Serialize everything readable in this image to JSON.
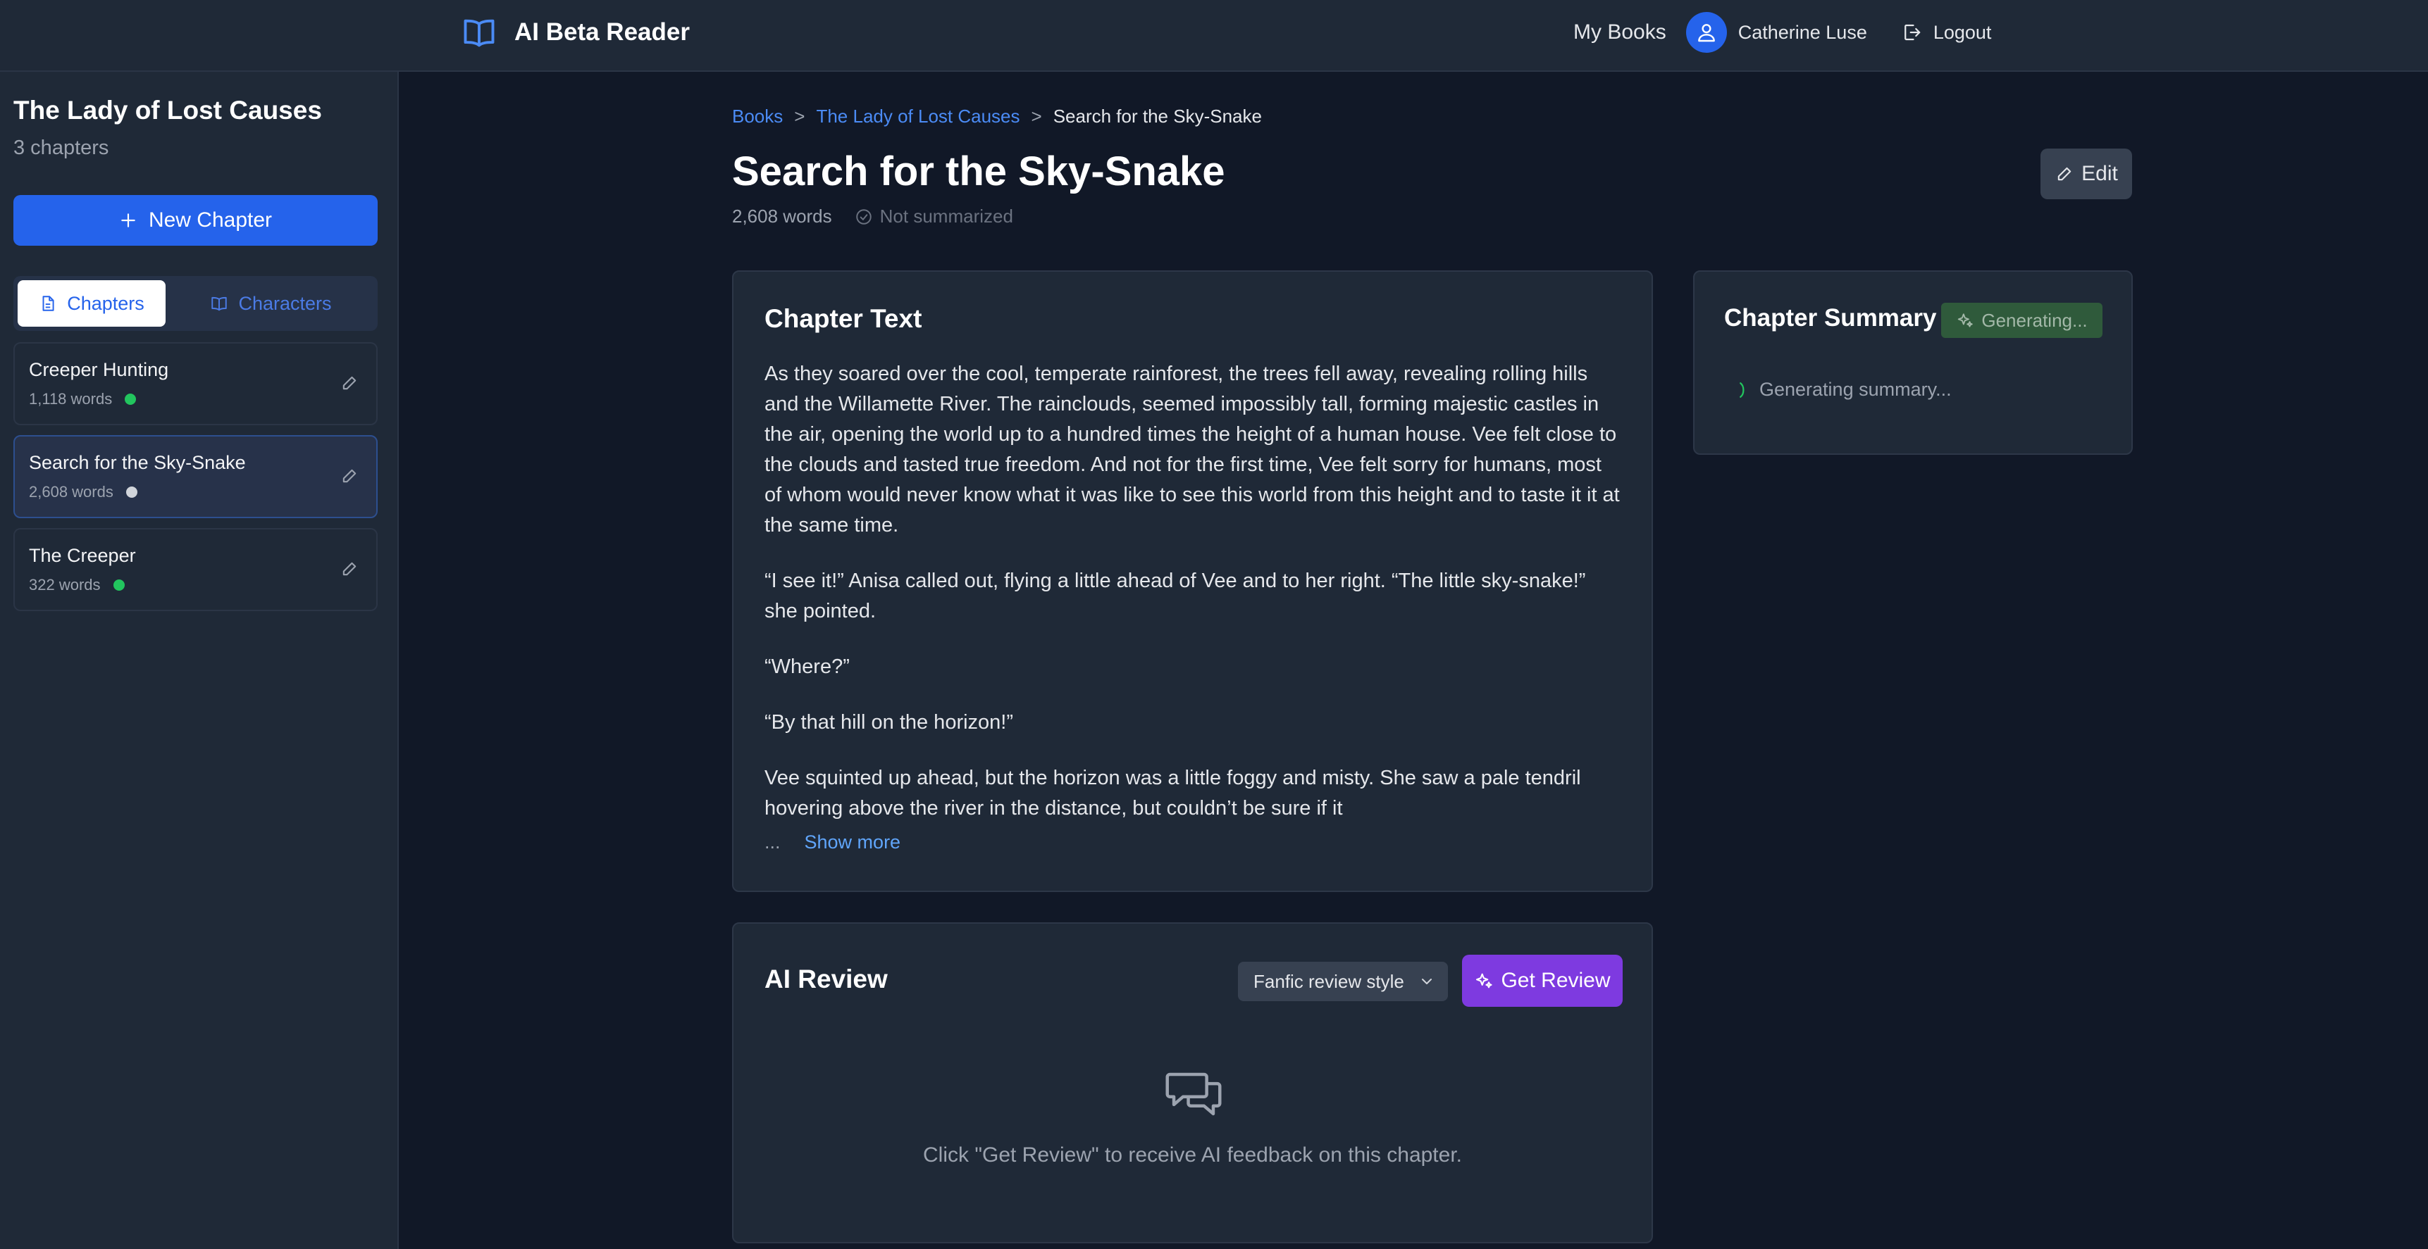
{
  "header": {
    "app_name": "AI Beta Reader",
    "my_books": "My Books",
    "user_name": "Catherine Luse",
    "logout": "Logout"
  },
  "sidebar": {
    "book_title": "The Lady of Lost Causes",
    "chapter_count": "3 chapters",
    "new_chapter": "New Chapter",
    "tabs": [
      {
        "label": "Chapters",
        "active": true,
        "icon": "document-icon"
      },
      {
        "label": "Characters",
        "active": false,
        "icon": "book-icon"
      }
    ],
    "chapters": [
      {
        "title": "Creeper Hunting",
        "words": "1,118 words",
        "status_color": "#22c55e",
        "selected": false
      },
      {
        "title": "Search for the Sky-Snake",
        "words": "2,608 words",
        "status_color": "#d1d5db",
        "selected": true
      },
      {
        "title": "The Creeper",
        "words": "322 words",
        "status_color": "#22c55e",
        "selected": false
      }
    ]
  },
  "main": {
    "breadcrumb": {
      "books": "Books",
      "sep": ">",
      "book": "The Lady of Lost Causes",
      "current": "Search for the Sky-Snake"
    },
    "title": "Search for the Sky-Snake",
    "word_count": "2,608 words",
    "summary_status": "Not summarized",
    "edit": "Edit",
    "chapter_text": {
      "heading": "Chapter Text",
      "paragraphs": [
        "As they soared over the cool, temperate rainforest, the trees fell away, revealing rolling hills and the Willamette River. The rainclouds, seemed impossibly tall, forming majestic castles in the air, opening the world up to a hundred times the height of a human house. Vee felt close to the clouds and tasted true freedom. And not for the first time, Vee felt sorry for humans, most of whom would never know what it was like to see this world from this height and to taste it it at the same time.",
        "“I see it!” Anisa called out, flying a little ahead of Vee and to her right. “The little sky-snake!” she pointed.",
        "“Where?”",
        "“By that hill on the horizon!”",
        "Vee squinted up ahead, but the horizon was a little foggy and misty. She saw a pale tendril hovering above the river in the distance, but couldn’t be sure if it"
      ],
      "ellipsis": "...",
      "show_more": "Show more"
    },
    "summary": {
      "heading": "Chapter Summary",
      "badge": "Generating...",
      "status": "Generating summary..."
    },
    "review": {
      "heading": "AI Review",
      "style": "Fanfic review style",
      "button": "Get Review",
      "empty_text": "Click \"Get Review\" to receive AI feedback on this chapter."
    }
  },
  "colors": {
    "accent": "#2563eb",
    "review_button": "#7e3ae0",
    "generating_badge": "#2f5a3b",
    "background": "#111827",
    "panel": "#1f2937"
  }
}
